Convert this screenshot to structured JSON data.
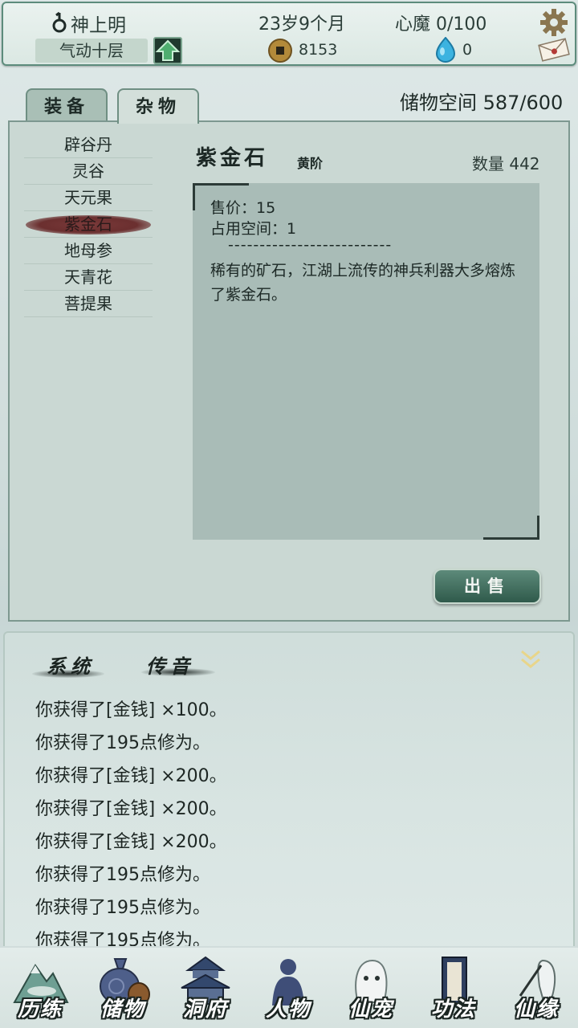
{
  "header": {
    "player_name": "神上明",
    "realm": "气动十层",
    "age": "23岁9个月",
    "heart_demon": "心魔 0/100",
    "coins": "8153",
    "gems": "0"
  },
  "tabs": [
    {
      "label": "装备",
      "active": false
    },
    {
      "label": "杂物",
      "active": true
    }
  ],
  "storage": "储物空间 587/600",
  "items": [
    {
      "label": "辟谷丹",
      "selected": false
    },
    {
      "label": "灵谷",
      "selected": false
    },
    {
      "label": "天元果",
      "selected": false
    },
    {
      "label": "紫金石",
      "selected": true
    },
    {
      "label": "地母参",
      "selected": false
    },
    {
      "label": "天青花",
      "selected": false
    },
    {
      "label": "菩提果",
      "selected": false
    }
  ],
  "detail": {
    "name": "紫金石",
    "grade": "黄阶",
    "quantity": "数量 442",
    "price": "售价：15",
    "space": "占用空间：1",
    "divider": "--------------------------",
    "description": "稀有的矿石，江湖上流传的神兵利器大多熔炼了紫金石。",
    "sell_label": "出售"
  },
  "log": {
    "tabs": [
      "系统",
      "传音"
    ],
    "lines": [
      "你获得了[金钱] ×100。",
      "你获得了195点修为。",
      "你获得了[金钱] ×200。",
      "你获得了[金钱] ×200。",
      "你获得了[金钱] ×200。",
      "你获得了195点修为。",
      "你获得了195点修为。",
      "你获得了195点修为。"
    ]
  },
  "nav": [
    {
      "label": "历练",
      "icon": "mountain-icon"
    },
    {
      "label": "储物",
      "icon": "bag-icon"
    },
    {
      "label": "洞府",
      "icon": "pagoda-icon"
    },
    {
      "label": "人物",
      "icon": "person-icon"
    },
    {
      "label": "仙宠",
      "icon": "ghost-pet-icon"
    },
    {
      "label": "功法",
      "icon": "scroll-book-icon"
    },
    {
      "label": "仙缘",
      "icon": "crane-icon"
    }
  ],
  "colors": {
    "accent": "#5d8c7c",
    "panel": "#cad8d3",
    "selected_brush": "#6b2f2f"
  }
}
